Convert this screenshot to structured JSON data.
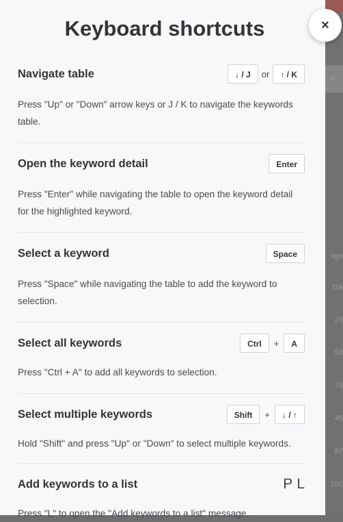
{
  "modal": {
    "title": "Keyboard shortcuts",
    "close_label": "×"
  },
  "sections": [
    {
      "title": "Navigate table",
      "keys": [
        "↓ / J",
        "↑ / K"
      ],
      "separator": "or",
      "description": "Press \"Up\" or \"Down\" arrow keys or J / K to navigate the keywords table."
    },
    {
      "title": "Open the keyword detail",
      "keys": [
        "Enter"
      ],
      "description": "Press \"Enter\" while navigating the table to open the keyword detail for the highlighted keyword."
    },
    {
      "title": "Select a keyword",
      "keys": [
        "Space"
      ],
      "description": "Press \"Space\" while navigating the table to add the keyword to selection."
    },
    {
      "title": "Select all keywords",
      "keys": [
        "Ctrl",
        "A"
      ],
      "separator": "+",
      "description": "Press \"Ctrl + A\" to add all keywords to selection."
    },
    {
      "title": "Select multiple keywords",
      "keys": [
        "Shift",
        "↓ / ↑"
      ],
      "separator": "+",
      "description": "Hold \"Shift\" and press \"Up\" or \"Down\" to select multiple keywords."
    },
    {
      "title": "Add keywords to a list",
      "keys": [
        "P",
        "L"
      ],
      "description": "Press \"L\" to open the \"Add keywords to a list\" message."
    }
  ],
  "background": {
    "col_text_1": "ago",
    "col_text_2": "DA",
    "values": [
      "29",
      "58",
      "78",
      "45",
      "87",
      "100"
    ]
  }
}
